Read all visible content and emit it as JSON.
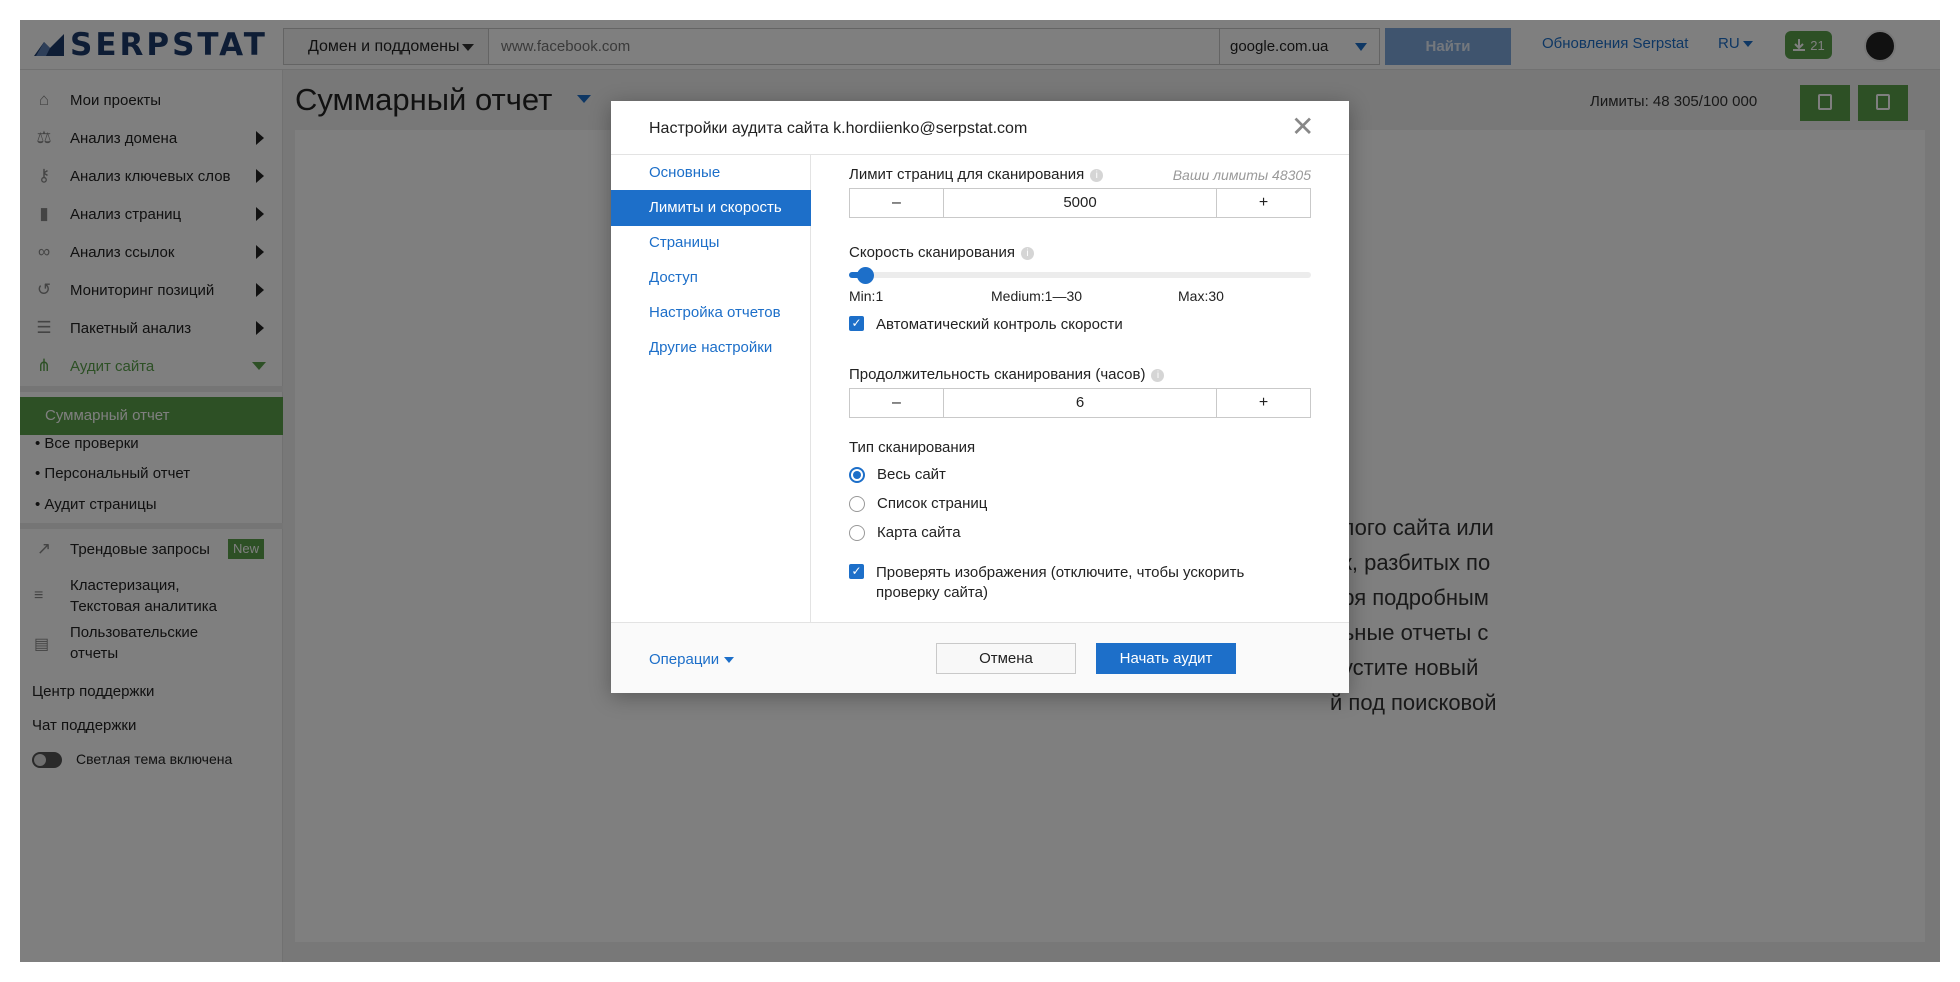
{
  "header": {
    "logo_text": "SERPSTAT",
    "domain_scope": "Домен и поддомены",
    "search_placeholder": "www.facebook.com",
    "search_engine": "google.com.ua",
    "find_label": "Найти",
    "updates_label": "Обновления Serpstat",
    "lang": "RU",
    "downloads_count": "21"
  },
  "sidebar": {
    "items": [
      {
        "label": "Мои проекты"
      },
      {
        "label": "Анализ домена"
      },
      {
        "label": "Анализ ключевых слов"
      },
      {
        "label": "Анализ страниц"
      },
      {
        "label": "Анализ ссылок"
      },
      {
        "label": "Мониторинг позиций"
      },
      {
        "label": "Пакетный анализ"
      },
      {
        "label": "Аудит сайта"
      }
    ],
    "sub_items": [
      {
        "label": "Суммарный отчет"
      },
      {
        "label": "• Все проверки"
      },
      {
        "label": "• Персональный отчет"
      },
      {
        "label": "• Аудит страницы"
      }
    ],
    "trend": {
      "label": "Трендовые запросы",
      "badge": "New"
    },
    "cluster": {
      "line1": "Кластеризация,",
      "line2": "Текстовая аналитика"
    },
    "user_reports": {
      "line1": "Пользовательские",
      "line2": "отчеты"
    },
    "support_center": "Центр поддержки",
    "support_chat": "Чат поддержки",
    "theme_label": "Светлая тема включена"
  },
  "main": {
    "page_title": "Суммарный отчет",
    "limits_text": "Лимиты: 48 305/100 000",
    "card_text": "елого сайта или\nок, разбитых по\nаря подробным\nльные отчеты с\nпустите новый\nй под поисковой"
  },
  "modal": {
    "title": "Настройки аудита сайта k.hordiienko@serpstat.com",
    "close": "✕",
    "tabs": [
      {
        "label": "Основные"
      },
      {
        "label": "Лимиты и скорость"
      },
      {
        "label": "Страницы"
      },
      {
        "label": "Доступ"
      },
      {
        "label": "Настройка отчетов"
      },
      {
        "label": "Другие настройки"
      }
    ],
    "page_limit_label": "Лимит страниц для сканирования",
    "your_limits": "Ваши лимиты 48305",
    "page_limit_value": "5000",
    "speed_label": "Скорость сканирования",
    "speed_min": "Min:1",
    "speed_medium": "Medium:1—30",
    "speed_max": "Max:30",
    "speed_value": 1,
    "speed_range": [
      1,
      30
    ],
    "auto_speed_label": "Автоматический контроль скорости",
    "duration_label": "Продолжительность сканирования (часов)",
    "duration_value": "6",
    "scan_type_label": "Тип сканирования",
    "scan_types": [
      {
        "label": "Весь сайт",
        "selected": true
      },
      {
        "label": "Список страниц",
        "selected": false
      },
      {
        "label": "Карта сайта",
        "selected": false
      }
    ],
    "check_images_line1": "Проверять изображения (отключите, чтобы ускорить",
    "check_images_line2": "проверку сайта)",
    "decrement": "–",
    "increment": "+",
    "operations_label": "Операции",
    "cancel_label": "Отмена",
    "start_label": "Начать аудит"
  },
  "colors": {
    "brand_green": "#5aa14b",
    "primary_blue": "#1d6fc9",
    "logo_navy": "#1c3a6b"
  }
}
